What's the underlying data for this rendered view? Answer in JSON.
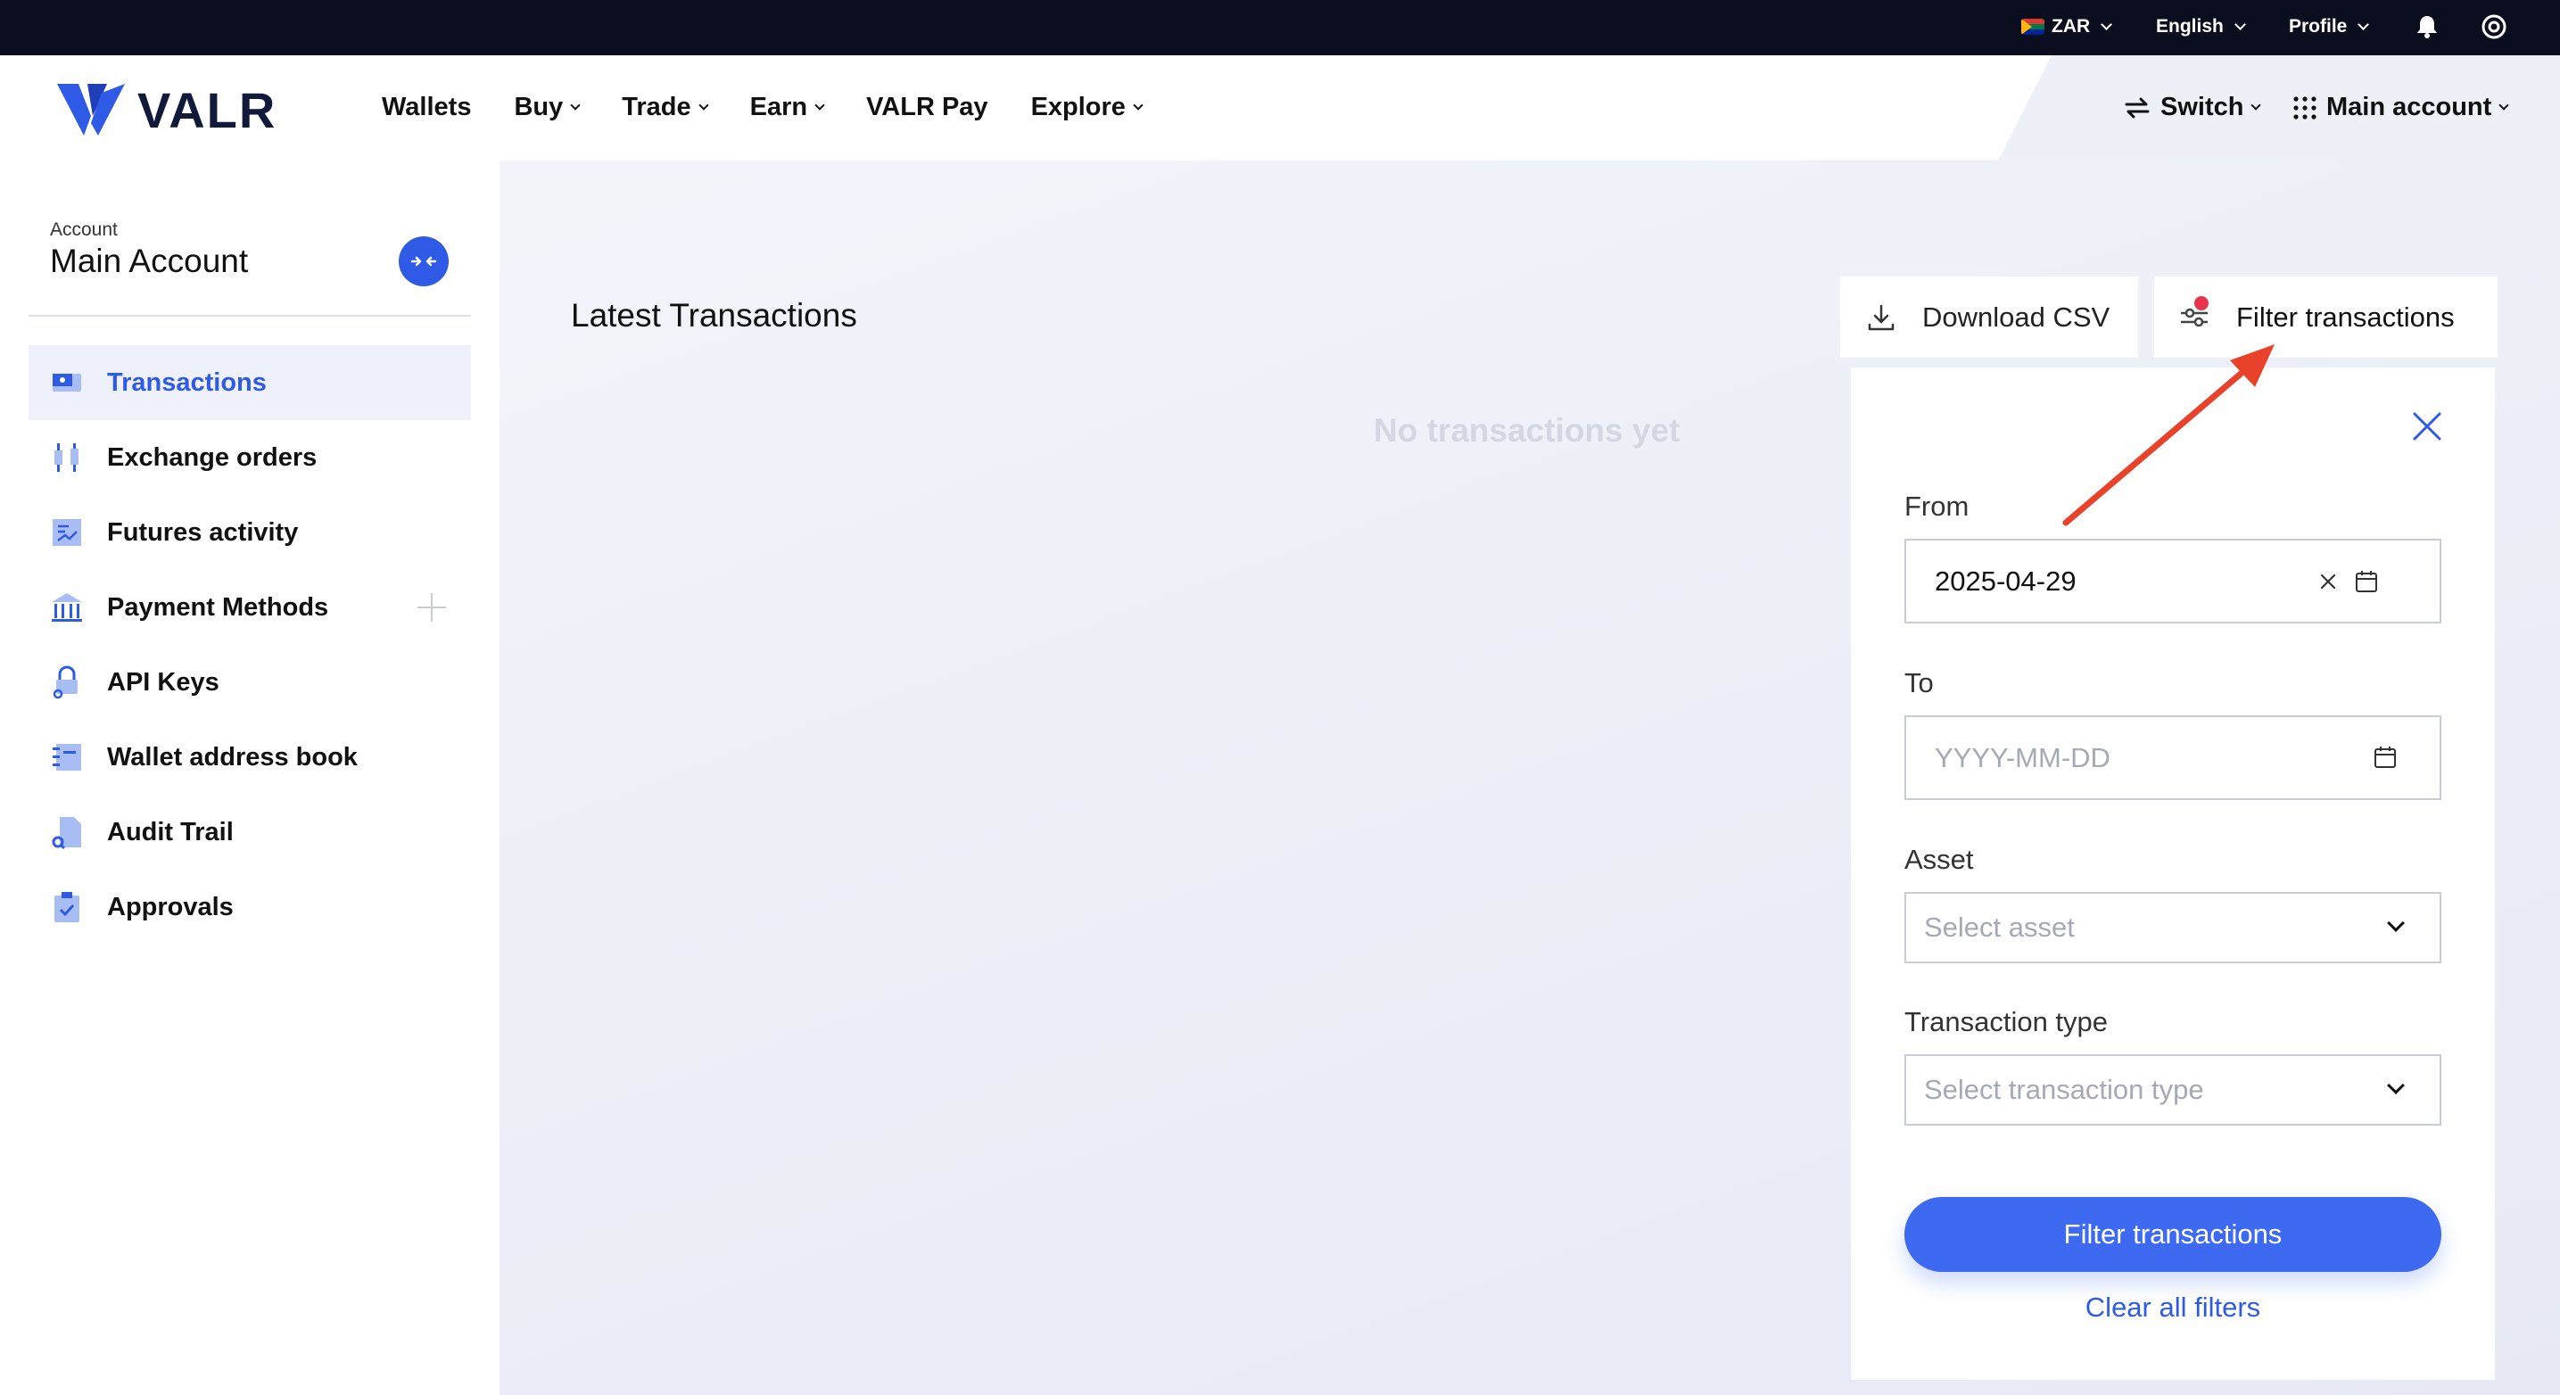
{
  "topbar": {
    "currency": "ZAR",
    "language": "English",
    "profile": "Profile"
  },
  "header": {
    "logo": "VALR",
    "nav": [
      "Wallets",
      "Buy",
      "Trade",
      "Earn",
      "VALR Pay",
      "Explore"
    ],
    "switch_label": "Switch",
    "account_label": "Main account"
  },
  "sidebar": {
    "account_caption": "Account",
    "account_name": "Main Account",
    "items": [
      {
        "label": "Transactions",
        "icon": "transactions-icon"
      },
      {
        "label": "Exchange orders",
        "icon": "candles-icon"
      },
      {
        "label": "Futures activity",
        "icon": "futures-icon"
      },
      {
        "label": "Payment Methods",
        "icon": "bank-icon"
      },
      {
        "label": "API Keys",
        "icon": "key-lock-icon"
      },
      {
        "label": "Wallet address book",
        "icon": "address-book-icon"
      },
      {
        "label": "Audit Trail",
        "icon": "audit-icon"
      },
      {
        "label": "Approvals",
        "icon": "clipboard-check-icon"
      }
    ]
  },
  "main": {
    "title": "Latest Transactions",
    "empty_state": "No transactions yet",
    "download_csv": "Download CSV",
    "filter_button": "Filter transactions"
  },
  "filter_panel": {
    "from_label": "From",
    "from_value": "2025-04-29",
    "to_label": "To",
    "to_placeholder": "YYYY-MM-DD",
    "asset_label": "Asset",
    "asset_placeholder": "Select asset",
    "type_label": "Transaction type",
    "type_placeholder": "Select transaction type",
    "submit": "Filter transactions",
    "clear": "Clear all filters"
  },
  "colors": {
    "accent": "#2f5ae6",
    "primary_button": "#3d6af0",
    "topbar": "#0b0e1e",
    "annotation_arrow": "#e8432a"
  }
}
